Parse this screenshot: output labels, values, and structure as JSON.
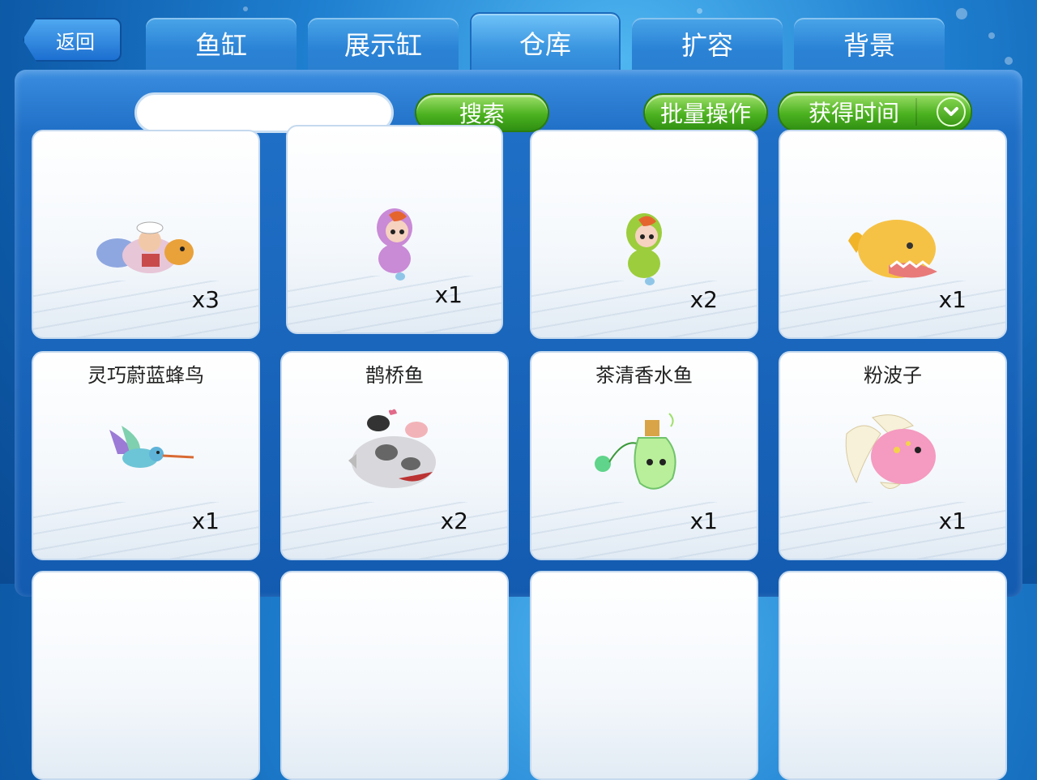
{
  "back_label": "返回",
  "tabs": [
    {
      "label": "鱼缸",
      "active": false
    },
    {
      "label": "展示缸",
      "active": false
    },
    {
      "label": "仓库",
      "active": true
    },
    {
      "label": "扩容",
      "active": false
    },
    {
      "label": "背景",
      "active": false
    }
  ],
  "toolbar": {
    "search_value": "",
    "search_button": "搜索",
    "batch_button": "批量操作",
    "sort_select": "获得时间"
  },
  "colors": {
    "accent": "#2b83d6",
    "button_green": "#4cb220"
  },
  "items_row1": [
    {
      "name": "",
      "count": "x3",
      "icon": "fish-group-icon"
    },
    {
      "name": "",
      "count": "x1",
      "icon": "purple-mushroom-kid-icon"
    },
    {
      "name": "",
      "count": "x2",
      "icon": "green-mushroom-kid-icon"
    },
    {
      "name": "",
      "count": "x1",
      "icon": "yellow-shark-icon"
    }
  ],
  "items_row2": [
    {
      "name": "灵巧蔚蓝蜂鸟",
      "count": "x1",
      "icon": "hummingbird-icon"
    },
    {
      "name": "鹊桥鱼",
      "count": "x2",
      "icon": "cow-fish-icon"
    },
    {
      "name": "茶清香水鱼",
      "count": "x1",
      "icon": "perfume-fish-icon"
    },
    {
      "name": "粉波子",
      "count": "x1",
      "icon": "pink-fish-icon"
    }
  ]
}
